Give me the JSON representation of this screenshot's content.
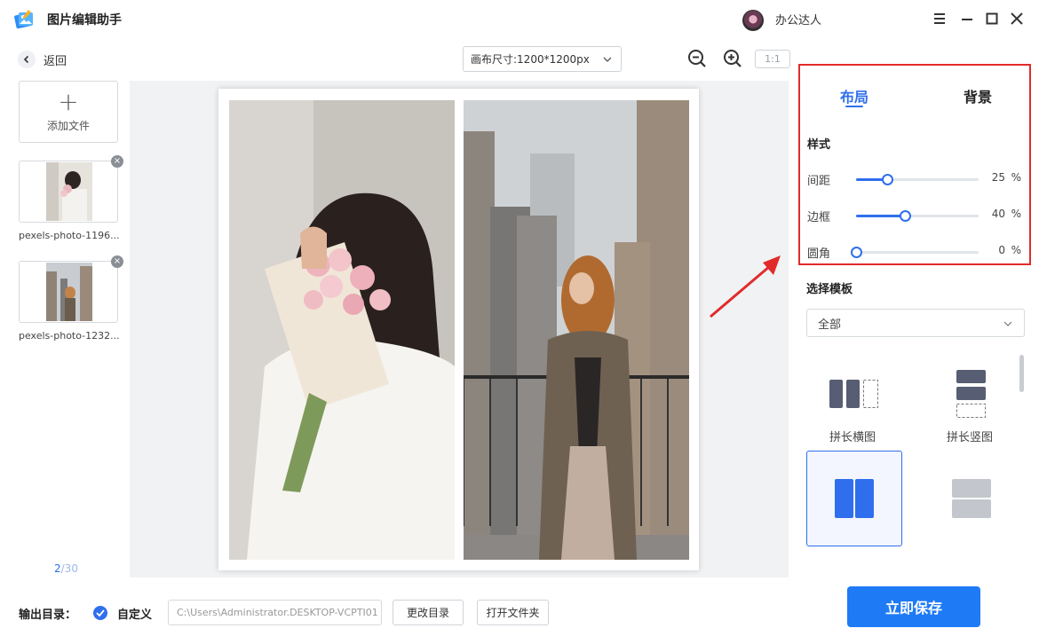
{
  "app": {
    "title": "图片编辑助手",
    "user": "办公达人"
  },
  "toolbar": {
    "back_label": "返回",
    "canvas_size": "画布尺寸:1200*1200px",
    "ratio_label": "1:1"
  },
  "files": {
    "add_label": "添加文件",
    "items": [
      {
        "name": "pexels-photo-1196..."
      },
      {
        "name": "pexels-photo-1232..."
      }
    ],
    "page_current": "2",
    "page_total": "/30"
  },
  "panel": {
    "tabs": [
      {
        "label": "布局",
        "active": true
      },
      {
        "label": "背景",
        "active": false
      }
    ],
    "style_title": "样式",
    "sliders": [
      {
        "label": "间距",
        "value": 25,
        "unit": "%"
      },
      {
        "label": "边框",
        "value": 40,
        "unit": "%"
      },
      {
        "label": "圆角",
        "value": 0,
        "unit": "%"
      }
    ],
    "template_title": "选择模板",
    "template_filter": "全部",
    "templates": [
      {
        "label": "拼长横图"
      },
      {
        "label": "拼长竖图"
      },
      {
        "label": ""
      },
      {
        "label": ""
      }
    ]
  },
  "bottom": {
    "output_label": "输出目录：",
    "custom_label": "自定义",
    "path": "C:\\Users\\Administrator.DESKTOP-VCPTI01",
    "change_dir": "更改目录",
    "open_folder": "打开文件夹",
    "save": "立即保存"
  },
  "colors": {
    "accent": "#2f6fed",
    "save": "#1f7bf5",
    "highlight": "#e12b2b"
  }
}
